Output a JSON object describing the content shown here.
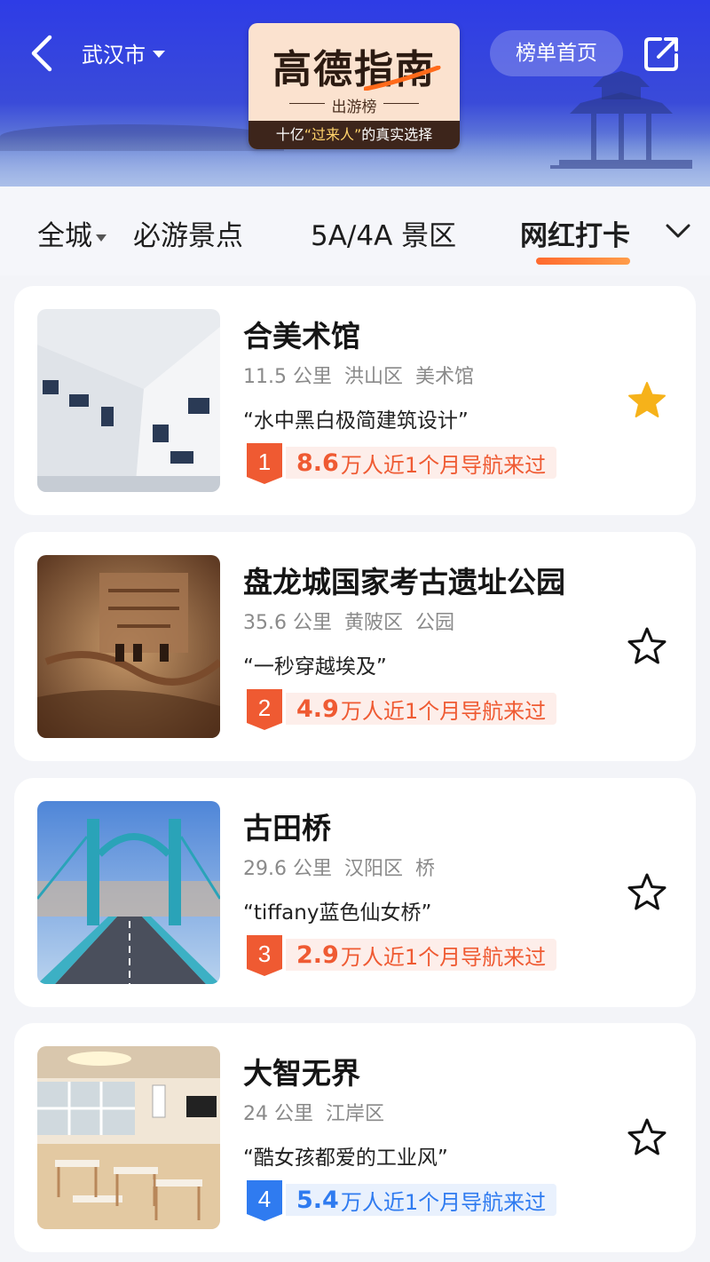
{
  "header": {
    "city": "武汉市",
    "logo_title": "高德指南",
    "logo_subtitle": "出游榜",
    "logo_tagline_prefix": "十亿",
    "logo_tagline_highlight": "“过来人”",
    "logo_tagline_suffix": "的真实选择",
    "home_label": "榜单首页"
  },
  "tabs": [
    {
      "label": "全城",
      "has_dropdown": true
    },
    {
      "label": "必游景点"
    },
    {
      "label": "5A/4A 景区"
    },
    {
      "label": "网红打卡",
      "active": true
    }
  ],
  "colors": {
    "accent": "#ff6a2e",
    "star_filled": "#f6b21a",
    "rank_red": "#ef5a32",
    "rank_blue": "#2f7bf0"
  },
  "places": [
    {
      "name": "合美术馆",
      "distance": "11.5 公里",
      "district": "洪山区",
      "category": "美术馆",
      "quote": "“水中黑白极简建筑设计”",
      "rank": "1",
      "count": "8.6",
      "count_suffix": "万人近1个月导航来过",
      "starred": true
    },
    {
      "name": "盘龙城国家考古遗址公园",
      "distance": "35.6 公里",
      "district": "黄陂区",
      "category": "公园",
      "quote": "“一秒穿越埃及”",
      "rank": "2",
      "count": "4.9",
      "count_suffix": "万人近1个月导航来过",
      "starred": false
    },
    {
      "name": "古田桥",
      "distance": "29.6 公里",
      "district": "汉阳区",
      "category": "桥",
      "quote": "“tiffany蓝色仙女桥”",
      "rank": "3",
      "count": "2.9",
      "count_suffix": "万人近1个月导航来过",
      "starred": false
    },
    {
      "name": "大智无界",
      "distance": "24 公里",
      "district": "江岸区",
      "category": "",
      "quote": "“酷女孩都爱的工业风”",
      "rank": "4",
      "count": "5.4",
      "count_suffix": "万人近1个月导航来过",
      "starred": false
    }
  ]
}
